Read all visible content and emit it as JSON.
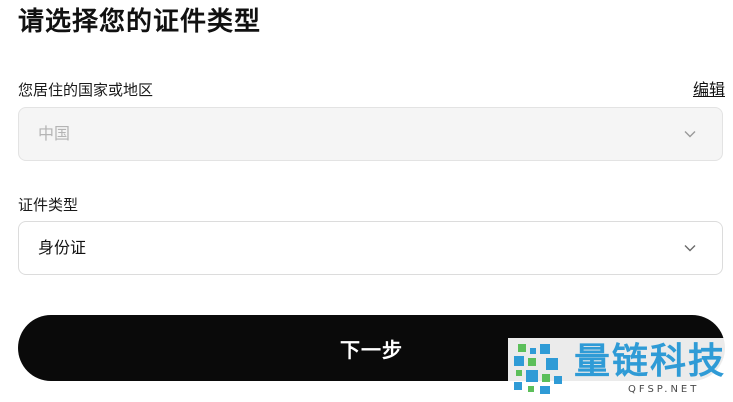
{
  "page": {
    "title": "请选择您的证件类型"
  },
  "country_field": {
    "label": "您居住的国家或地区",
    "edit_label": "编辑",
    "value": "中国",
    "disabled": true
  },
  "id_type_field": {
    "label": "证件类型",
    "value": "身份证"
  },
  "actions": {
    "next_label": "下一步"
  },
  "watermark": {
    "name": "量链科技",
    "domain": "QFSP.NET"
  },
  "colors": {
    "button_bg": "#0a0a0a",
    "button_text": "#ffffff",
    "disabled_bg": "#f5f5f5",
    "disabled_text": "#b4b4b4",
    "watermark_blue": "#2f9bd6",
    "watermark_green": "#5cbf5a"
  },
  "icons": {
    "select_chevron": "chevron-down-icon",
    "watermark_logo": "pixel-logo-icon"
  }
}
